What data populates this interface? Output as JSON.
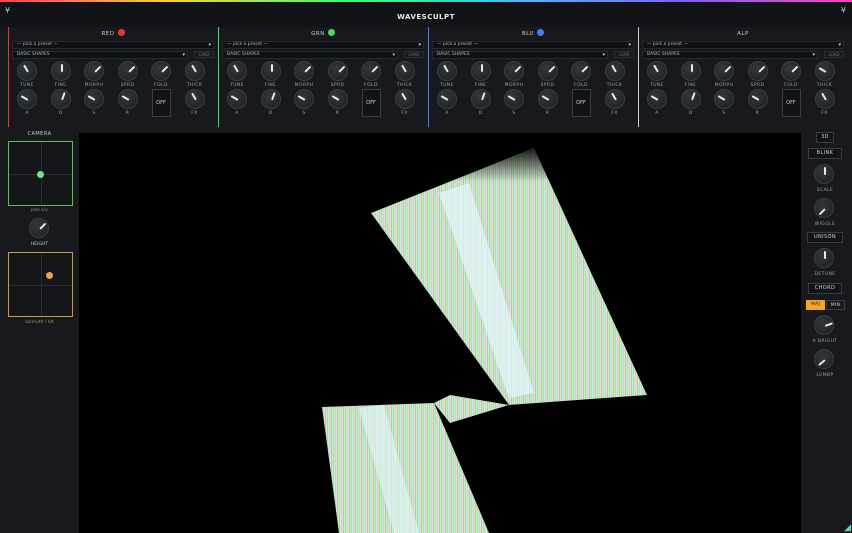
{
  "app": {
    "title": "WAVESCULPT",
    "corner_glyph": "¥"
  },
  "colors": {
    "red": "#e53935",
    "grn": "#4cd964",
    "blu": "#4a7bf7",
    "alp": "#9aa0a8",
    "camera": "#55c05a",
    "orbit": "#c89a3a",
    "accent": "#f5a623"
  },
  "panels": [
    {
      "id": "red",
      "name": "RED",
      "led": "#e53935",
      "preset_placeholder": "— pick a preset —",
      "bank": "BASIC SHAPES",
      "load_label": "LOAD",
      "row1": [
        "TUNE",
        "FINE",
        "MORPH",
        "SPRD",
        "FOLD",
        "THICK"
      ],
      "row2": [
        "A",
        "D",
        "S",
        "R",
        "OFF",
        "FX"
      ]
    },
    {
      "id": "grn",
      "name": "GRN",
      "led": "#4cd964",
      "preset_placeholder": "— pick a preset —",
      "bank": "BASIC SHAPES",
      "load_label": "LOAD",
      "row1": [
        "TUNE",
        "FINE",
        "MORPH",
        "SPRD",
        "FOLD",
        "THICK"
      ],
      "row2": [
        "A",
        "D",
        "S",
        "R",
        "OFF",
        "FX"
      ]
    },
    {
      "id": "blu",
      "name": "BLU",
      "led": "#4a7bf7",
      "preset_placeholder": "— pick a preset —",
      "bank": "BASIC SHAPES",
      "load_label": "LOAD",
      "row1": [
        "TUNE",
        "FINE",
        "MORPH",
        "SPRD",
        "FOLD",
        "THICK"
      ],
      "row2": [
        "A",
        "D",
        "S",
        "R",
        "OFF",
        "FX"
      ]
    },
    {
      "id": "alp",
      "name": "ALP",
      "led": "",
      "preset_placeholder": "— pick a preset —",
      "bank": "BASIC SHAPES",
      "load_label": "LOAD",
      "row1": [
        "TUNE",
        "FINE",
        "MORPH",
        "SPRD",
        "FOLD",
        "THICK"
      ],
      "row2": [
        "A",
        "D",
        "S",
        "R",
        "OFF",
        "FX"
      ]
    }
  ],
  "left": {
    "camera_label": "CAMERA",
    "pan_caption": "pan x/y",
    "height_label": "HEIGHT",
    "orbit_caption": "azimuth / tilt"
  },
  "right": {
    "btn_3d": "3D",
    "btn_blink": "BLINK",
    "scale_label": "SCALE",
    "wiggle_label": "WIGGLE",
    "btn_unison": "UNISON",
    "detune_label": "DETUNE",
    "btn_chord": "CHORD",
    "maj": "MAJ",
    "min": "MIN",
    "bright_label": "A BRIGHT",
    "lumbp_label": "LUMBP"
  }
}
